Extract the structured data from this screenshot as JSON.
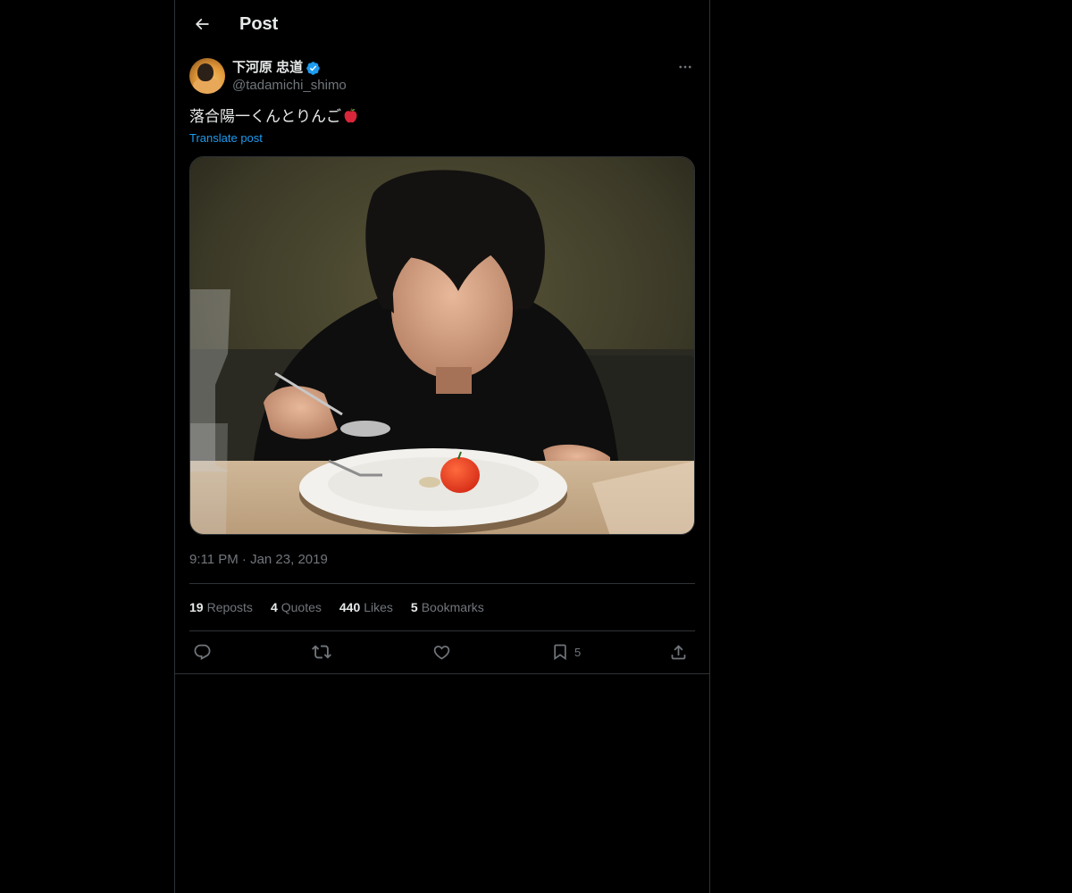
{
  "header": {
    "title": "Post"
  },
  "author": {
    "display_name": "下河原 忠道",
    "handle": "@tadamichi_shimo",
    "verified": true
  },
  "post": {
    "text": "落合陽一くんとりんご",
    "emoji": "apple-emoji",
    "translate_label": "Translate post",
    "timestamp": "9:11 PM · Jan 23, 2019"
  },
  "stats": {
    "reposts_count": "19",
    "reposts_label": "Reposts",
    "quotes_count": "4",
    "quotes_label": "Quotes",
    "likes_count": "440",
    "likes_label": "Likes",
    "bookmarks_count": "5",
    "bookmarks_label": "Bookmarks"
  },
  "actions": {
    "bookmark_count": "5"
  },
  "colors": {
    "background": "#000000",
    "text_primary": "#e7e9ea",
    "text_secondary": "#71767b",
    "accent": "#1d9bf0",
    "border": "#2f3336"
  }
}
